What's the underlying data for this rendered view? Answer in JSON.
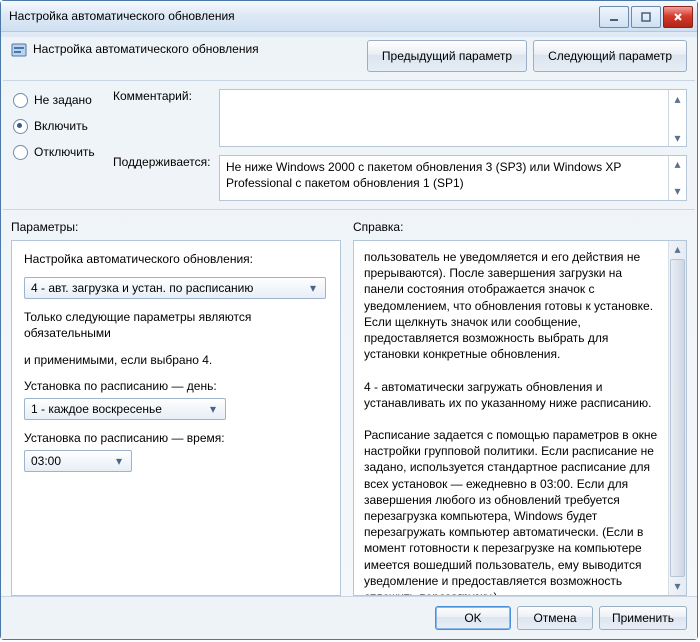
{
  "window": {
    "title": "Настройка автоматического обновления"
  },
  "header": {
    "title": "Настройка автоматического обновления",
    "prev": "Предыдущий параметр",
    "next": "Следующий параметр"
  },
  "state": {
    "not_configured": "Не задано",
    "enabled": "Включить",
    "disabled": "Отключить",
    "selected": "enabled"
  },
  "comment": {
    "label": "Комментарий:",
    "value": ""
  },
  "supported": {
    "label": "Поддерживается:",
    "text": "Не ниже Windows 2000 с пакетом обновления 3 (SP3) или Windows XP Professional с пакетом обновления 1 (SP1)"
  },
  "params": {
    "label": "Параметры:"
  },
  "help_section": {
    "label": "Справка:"
  },
  "options": {
    "heading": "Настройка автоматического обновления:",
    "mode_value": "4 - авт. загрузка и устан. по расписанию",
    "note1": "Только следующие параметры являются обязательными",
    "note2": "и применимыми, если выбрано 4.",
    "day_label": "Установка по расписанию — день:",
    "day_value": "1 - каждое воскресенье",
    "time_label": "Установка по расписанию — время:",
    "time_value": "03:00"
  },
  "help": {
    "text": "пользователь не уведомляется и его действия не прерываются). После завершения загрузки на панели состояния отображается значок с уведомлением, что обновления готовы к установке. Если щелкнуть значок или сообщение, предоставляется возможность выбрать для установки конкретные обновления.\n\n4 - автоматически загружать обновления и устанавливать их по указанному ниже расписанию.\n\nРасписание задается с помощью параметров в окне настройки групповой политики. Если расписание не задано, используется стандартное расписание для всех установок — ежедневно в 03:00. Если для завершения любого из обновлений требуется перезагрузка компьютера, Windows будет перезагружать компьютер автоматически. (Если в момент готовности к перезагрузке на компьютере имеется вошедший пользователь, ему выводится уведомление и предоставляется возможность отложить перезагрузку.)"
  },
  "footer": {
    "ok": "OK",
    "cancel": "Отмена",
    "apply": "Применить"
  }
}
